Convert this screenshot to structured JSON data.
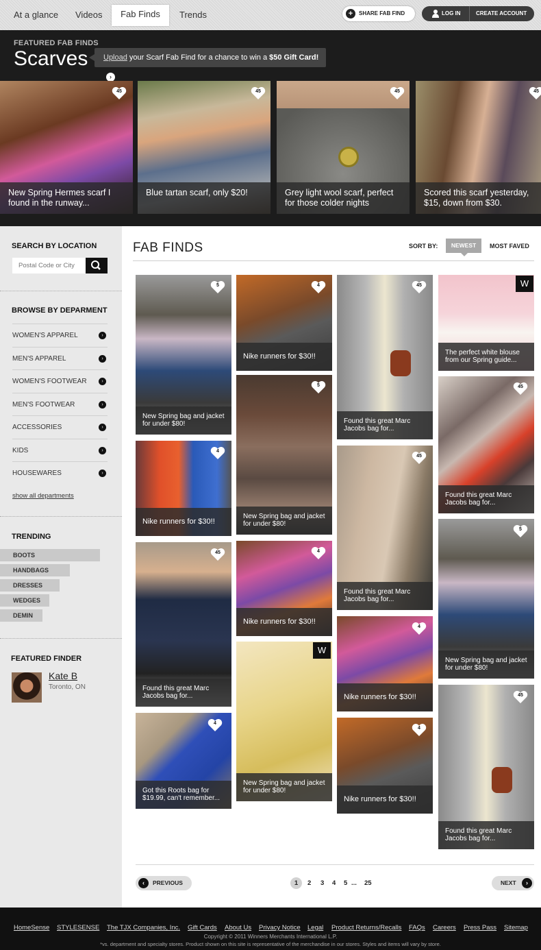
{
  "nav": {
    "tabs": [
      "At a glance",
      "Videos",
      "Fab Finds",
      "Trends"
    ],
    "share_label": "SHARE FAB FIND",
    "login_label": "LOG IN",
    "create_label": "CREATE ACCOUNT"
  },
  "hero": {
    "label": "FEATURED FAB FINDS",
    "title": "Scarves",
    "upload_link": "Upload",
    "upload_text": " your Scarf Fab Find for a chance to win a ",
    "upload_prize": "$50 Gift Card!",
    "cards": [
      {
        "caption": "New Spring Hermes scarf I found in the runway...",
        "count": "45"
      },
      {
        "caption": "Blue tartan scarf, only $20!",
        "count": "45"
      },
      {
        "caption": "Grey light wool scarf, perfect for those colder nights",
        "count": "45"
      },
      {
        "caption": "Scored this scarf yesterday, $15, down from $30.",
        "count": "45"
      }
    ]
  },
  "sidebar": {
    "search_title": "SEARCH BY LOCATION",
    "search_placeholder": "Postal Code or City",
    "browse_title": "BROWSE BY DEPARMENT",
    "departments": [
      "WOMEN'S APPAREL",
      "MEN'S APPAREL",
      "WOMEN'S FOOTWEAR",
      "MEN'S FOOTWEAR",
      "ACCESSORIES",
      "KIDS",
      "HOUSEWARES"
    ],
    "show_all": "show all departments",
    "trending_title": "TRENDING",
    "trending": [
      "BOOTS",
      "HANDBAGS",
      "DRESSES",
      "WEDGES",
      "DEMIN"
    ],
    "finder_title": "FEATURED FINDER",
    "finder_name": "Kate B",
    "finder_location": "Toronto, ON"
  },
  "main": {
    "title": "FAB FINDS",
    "sort_label": "SORT BY:",
    "sort_newest": "NEWEST",
    "sort_most_faved": "MOST FAVED"
  },
  "finds": [
    {
      "caption": "New Spring bag and jacket for under $80!",
      "count": "5"
    },
    {
      "caption": "Nike runners for $30!!",
      "count": "4"
    },
    {
      "caption": "Found this great Marc Jacobs bag for...",
      "count": "45"
    },
    {
      "caption": "Got this Roots bag for $19.99, can't remember...",
      "count": "4"
    },
    {
      "caption": "Nike runners for $30!!",
      "count": "4"
    },
    {
      "caption": "New Spring bag and jacket for under $80!",
      "count": "5"
    },
    {
      "caption": "Nike runners for $30!!",
      "count": "4"
    },
    {
      "caption": "New Spring bag and jacket for under $80!",
      "badge": "W"
    },
    {
      "caption": "Found this great Marc Jacobs bag for...",
      "count": "45"
    },
    {
      "caption": "Found this great Marc Jacobs bag for...",
      "count": "45"
    },
    {
      "caption": "Nike runners for $30!!",
      "count": "4"
    },
    {
      "caption": "Nike runners for $30!!",
      "count": "4"
    },
    {
      "caption": "The perfect white blouse from our Spring guide...",
      "badge": "W"
    },
    {
      "caption": "Found this great Marc Jacobs bag for...",
      "count": "45"
    },
    {
      "caption": "New Spring bag and jacket for under $80!",
      "count": "5"
    },
    {
      "caption": "Found this great Marc Jacobs bag for...",
      "count": "45"
    }
  ],
  "pagination": {
    "prev": "PREVIOUS",
    "next": "NEXT",
    "pages": [
      "1",
      "2",
      "3",
      "4",
      "5",
      "...",
      "25"
    ],
    "current": "1"
  },
  "footer": {
    "links": [
      "HomeSense",
      "STYLESENSE",
      "The TJX Companies, Inc.",
      "Gift Cards",
      "About Us",
      "Privacy Notice",
      "Legal",
      "Product Returns/Recalls",
      "FAQs",
      "Careers",
      "Press Pass",
      "Sitemap"
    ],
    "copyright": "Copyright © 2011 Winners Merchants International L.P.",
    "note": "*vs. department and specialty stores. Product shown on this site is representative of the merchandise in our stores. Styles and items will vary by store."
  },
  "colors": {
    "dark": "#1c1c1c",
    "sidebar": "#e9e9e9",
    "accent": "#a8a8a8"
  }
}
